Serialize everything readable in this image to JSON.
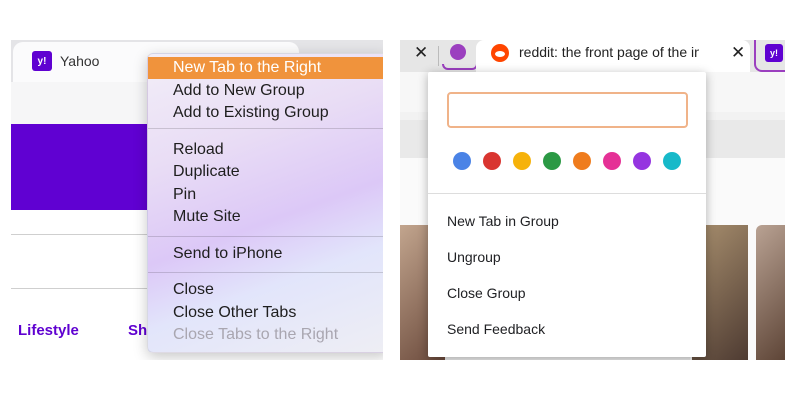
{
  "left": {
    "tab_title": "Yahoo",
    "favicon_text": "y!",
    "nav": [
      "Lifestyle",
      "Sh"
    ],
    "context_menu": [
      {
        "label": "New Tab to the Right",
        "state": "highlighted"
      },
      {
        "label": "Add to New Group",
        "state": "normal"
      },
      {
        "label": "Add to Existing Group",
        "state": "normal"
      },
      {
        "label": "Reload",
        "state": "normal"
      },
      {
        "label": "Duplicate",
        "state": "normal"
      },
      {
        "label": "Pin",
        "state": "normal"
      },
      {
        "label": "Mute Site",
        "state": "normal"
      },
      {
        "label": "Send to iPhone",
        "state": "normal"
      },
      {
        "label": "Close",
        "state": "normal"
      },
      {
        "label": "Close Other Tabs",
        "state": "normal"
      },
      {
        "label": "Close Tabs to the Right",
        "state": "disabled"
      }
    ]
  },
  "right": {
    "tab_title": "reddit: the front page of the inter",
    "favicon_text": "y!",
    "group_popup": {
      "name_value": "",
      "colors": [
        "#4a83e6",
        "#d93530",
        "#f6b20a",
        "#2b9944",
        "#ef7c1d",
        "#e53196",
        "#9535e0",
        "#17b9c9"
      ],
      "items": [
        "New Tab in Group",
        "Ungroup",
        "Close Group",
        "Send Feedback"
      ]
    }
  },
  "colors": {
    "yahoo_purple": "#6001d2",
    "highlight": "#f0933c",
    "group_accent": "#9b3fbf"
  }
}
